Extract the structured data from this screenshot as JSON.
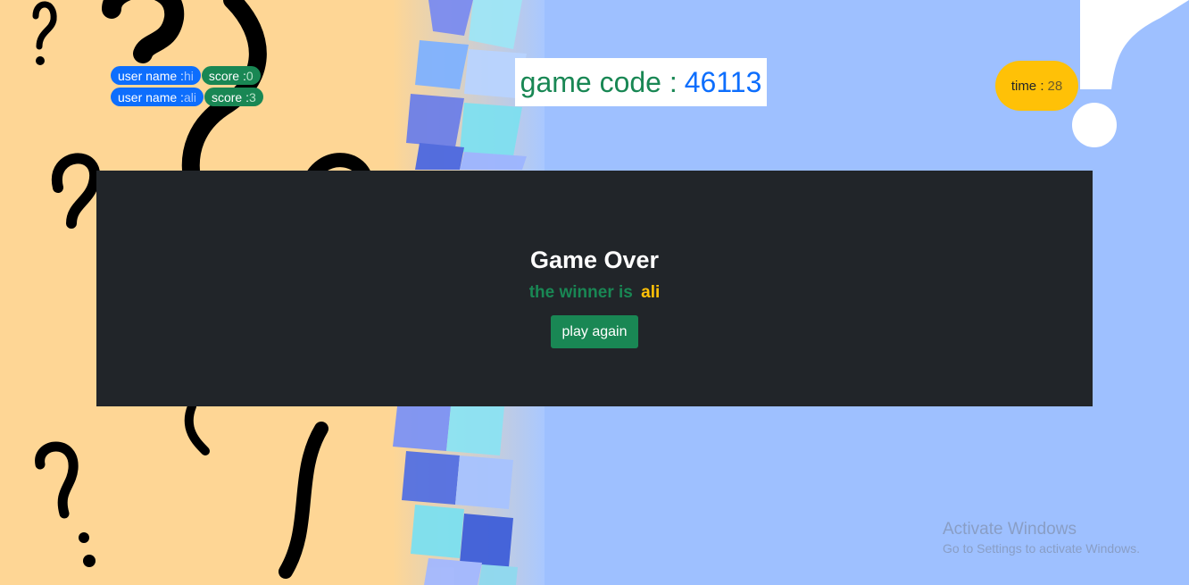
{
  "players": [
    {
      "user_label": "user name : ",
      "user_name": "hi",
      "score_label": "score : ",
      "score": "0"
    },
    {
      "user_label": "user name : ",
      "user_name": "ali",
      "score_label": "score : ",
      "score": "3"
    }
  ],
  "game_code": {
    "label": "game code :",
    "code": "46113"
  },
  "timer": {
    "label": "time :",
    "value": "28"
  },
  "modal": {
    "title": "Game Over",
    "winner_label": "the winner is",
    "winner_name": "ali",
    "play_again_label": "play again"
  },
  "watermark": {
    "line1": "Activate Windows",
    "line2": "Go to Settings to activate Windows."
  },
  "colors": {
    "primary": "#0d6efd",
    "success": "#198754",
    "warning": "#ffc107",
    "dark": "#212529",
    "bg_left": "#fed695",
    "bg_right": "#9ec0ff"
  }
}
